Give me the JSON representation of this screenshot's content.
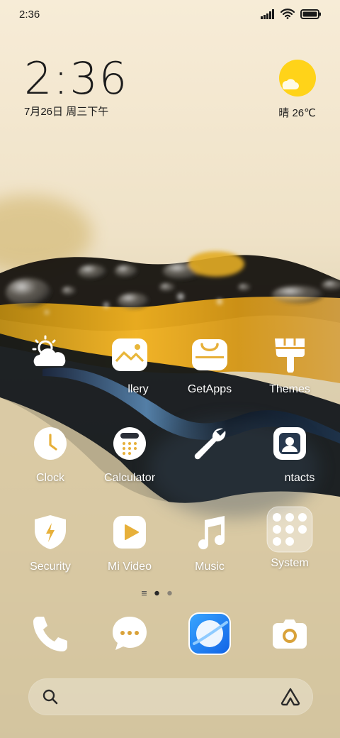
{
  "status_bar": {
    "time": "2:36"
  },
  "clock_widget": {
    "time": "2:36",
    "date": "7月26日 周三下午"
  },
  "weather_widget": {
    "text": "晴 26℃",
    "icon": "sun-cloud-icon"
  },
  "apps": [
    {
      "name": "Weather",
      "label": "",
      "icon": "weather-icon"
    },
    {
      "name": "Gallery",
      "label": "llery",
      "icon": "gallery-icon"
    },
    {
      "name": "GetApps",
      "label": "GetApps",
      "icon": "getapps-icon"
    },
    {
      "name": "Themes",
      "label": "Themes",
      "icon": "themes-icon"
    },
    {
      "name": "Clock",
      "label": "Clock",
      "icon": "clock-icon"
    },
    {
      "name": "Calculator",
      "label": "Calculator",
      "icon": "calculator-icon"
    },
    {
      "name": "Settings",
      "label": "",
      "icon": "wrench-icon"
    },
    {
      "name": "Contacts",
      "label": "ntacts",
      "icon": "contacts-icon"
    },
    {
      "name": "Security",
      "label": "Security",
      "icon": "security-icon"
    },
    {
      "name": "Mi Video",
      "label": "Mi Video",
      "icon": "mivideo-icon"
    },
    {
      "name": "Music",
      "label": "Music",
      "icon": "music-icon"
    },
    {
      "name": "System",
      "label": "System",
      "icon": "system-folder-icon"
    }
  ],
  "dock": [
    {
      "name": "Phone",
      "icon": "phone-icon"
    },
    {
      "name": "Messaging",
      "icon": "messaging-icon"
    },
    {
      "name": "Browser",
      "icon": "browser-icon"
    },
    {
      "name": "Camera",
      "icon": "camera-icon"
    }
  ],
  "page_indicator": {
    "pages": 2,
    "current": 1
  },
  "search_bar": {
    "left_icon": "search-icon",
    "right_icon": "assistant-icon"
  },
  "colors": {
    "accent_sun": "#ffd319",
    "browser_blue": "#2d8cff",
    "label": "#ffffff"
  }
}
